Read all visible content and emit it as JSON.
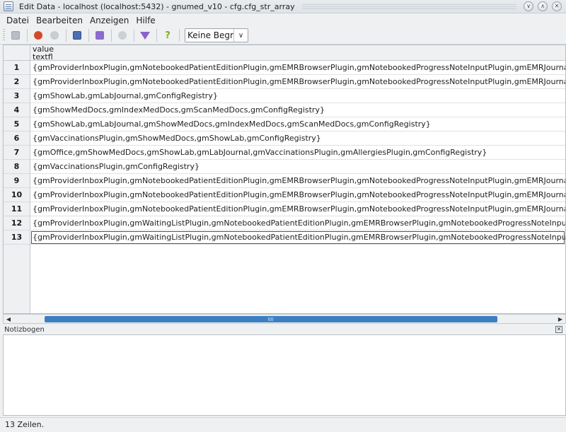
{
  "window": {
    "title": "Edit Data - localhost (localhost:5432) - gnumed_v10 - cfg.cfg_str_array",
    "minimize_glyph": "∨",
    "maximize_glyph": "∧",
    "close_glyph": "✕"
  },
  "menu": [
    {
      "label": "Datei"
    },
    {
      "label": "Bearbeiten"
    },
    {
      "label": "Anzeigen"
    },
    {
      "label": "Hilfe"
    }
  ],
  "toolbar": {
    "filter_select": "Keine Begre",
    "help_glyph": "?",
    "icons": [
      "save-icon",
      "undo-icon",
      "redo-icon",
      "copy-icon",
      "search-icon",
      "clear-filter-icon",
      "filter-icon",
      "help-icon"
    ]
  },
  "grid": {
    "column_header_line1": "value",
    "column_header_line2": "textfl",
    "rows": [
      {
        "num": "1",
        "value": "{gmProviderInboxPlugin,gmNotebookedPatientEditionPlugin,gmEMRBrowserPlugin,gmNotebookedProgressNoteInputPlugin,gmEMRJournalPlugin,gmShowMedDocs"
      },
      {
        "num": "2",
        "value": "{gmProviderInboxPlugin,gmNotebookedPatientEditionPlugin,gmEMRBrowserPlugin,gmNotebookedProgressNoteInputPlugin,gmEMRJournalPlugin,gmShowMedDocs"
      },
      {
        "num": "3",
        "value": "{gmShowLab,gmLabJournal,gmConfigRegistry}"
      },
      {
        "num": "4",
        "value": "{gmShowMedDocs,gmIndexMedDocs,gmScanMedDocs,gmConfigRegistry}"
      },
      {
        "num": "5",
        "value": "{gmShowLab,gmLabJournal,gmShowMedDocs,gmIndexMedDocs,gmScanMedDocs,gmConfigRegistry}"
      },
      {
        "num": "6",
        "value": "{gmVaccinationsPlugin,gmShowMedDocs,gmShowLab,gmConfigRegistry}"
      },
      {
        "num": "7",
        "value": "{gmOffice,gmShowMedDocs,gmShowLab,gmLabJournal,gmVaccinationsPlugin,gmAllergiesPlugin,gmConfigRegistry}"
      },
      {
        "num": "8",
        "value": "{gmVaccinationsPlugin,gmConfigRegistry}"
      },
      {
        "num": "9",
        "value": "{gmProviderInboxPlugin,gmNotebookedPatientEditionPlugin,gmEMRBrowserPlugin,gmNotebookedProgressNoteInputPlugin,gmEMRJournalPlugin,gmShowMedDocs"
      },
      {
        "num": "10",
        "value": "{gmProviderInboxPlugin,gmNotebookedPatientEditionPlugin,gmEMRBrowserPlugin,gmNotebookedProgressNoteInputPlugin,gmEMRJournalPlugin,gmShowMedDocs"
      },
      {
        "num": "11",
        "value": "{gmProviderInboxPlugin,gmNotebookedPatientEditionPlugin,gmEMRBrowserPlugin,gmNotebookedProgressNoteInputPlugin,gmEMRJournalPlugin,gmShowMedDocs"
      },
      {
        "num": "12",
        "value": "{gmProviderInboxPlugin,gmWaitingListPlugin,gmNotebookedPatientEditionPlugin,gmEMRBrowserPlugin,gmNotebookedProgressNoteInputPlugin,gmEMRJournal"
      },
      {
        "num": "13",
        "value": "{gmProviderInboxPlugin,gmWaitingListPlugin,gmNotebookedPatientEditionPlugin,gmEMRBrowserPlugin,gmNotebookedProgressNoteInputPlugin,gmEMRJournal"
      }
    ]
  },
  "scrollbar": {
    "left_glyph": "◀",
    "right_glyph": "▶"
  },
  "notes": {
    "title": "Notizbogen",
    "close_glyph": "✕"
  },
  "status": {
    "text": "13 Zeilen."
  }
}
